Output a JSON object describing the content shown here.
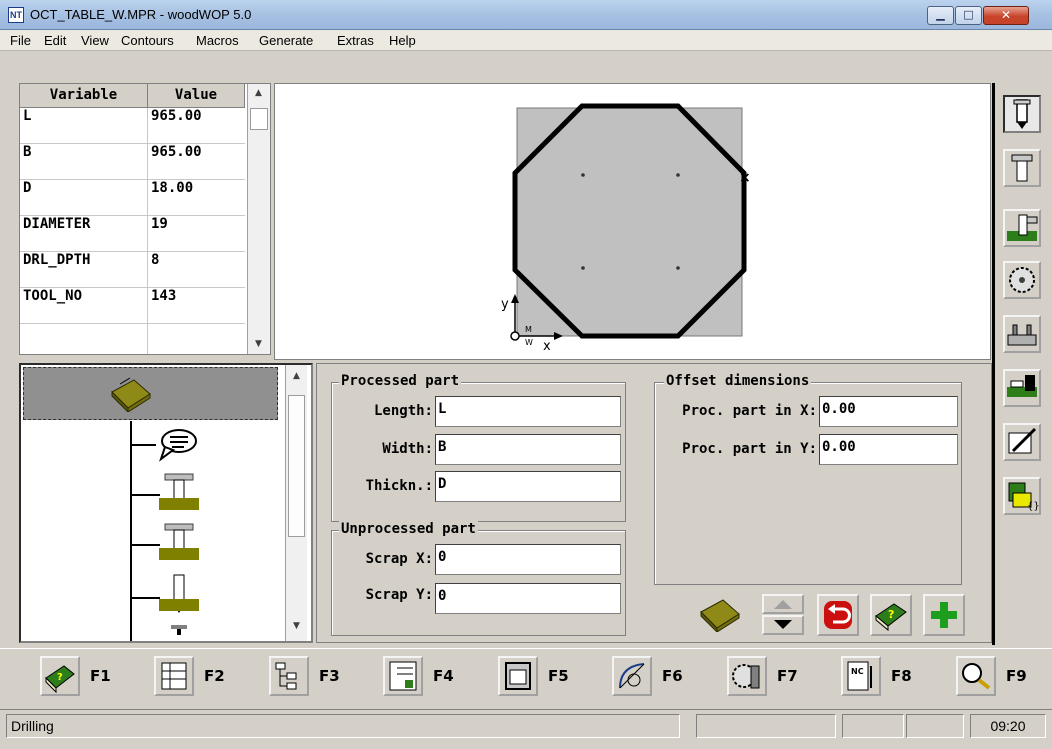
{
  "window": {
    "title": "OCT_TABLE_W.MPR - woodWOP 5.0",
    "icon_text": "NT",
    "minimize_glyph": "▁",
    "maximize_glyph": "□",
    "close_glyph": "✕"
  },
  "menu": [
    "File",
    "Edit",
    "View",
    "Contours",
    "Macros",
    "Generate",
    "Extras",
    "Help"
  ],
  "variables": {
    "headers": [
      "Variable",
      "Value"
    ],
    "rows": [
      {
        "name": "L",
        "value": "965.00"
      },
      {
        "name": "B",
        "value": "965.00"
      },
      {
        "name": "D",
        "value": "18.00"
      },
      {
        "name": "DIAMETER",
        "value": "19"
      },
      {
        "name": "DRL_DPTH",
        "value": "8"
      },
      {
        "name": "TOOL_NO",
        "value": "143"
      },
      {
        "name": "",
        "value": ""
      }
    ]
  },
  "graphic": {
    "axis_y": "y",
    "axis_x": "x",
    "origin_m": "M",
    "origin_w": "W"
  },
  "tree": {
    "items": [
      "workpiece-icon",
      "comment-icon",
      "drill-icon",
      "drill-icon",
      "drill-icon",
      "drill-icon"
    ]
  },
  "processed_part": {
    "title": "Processed part",
    "length_label": "Length:",
    "length_value": "L",
    "width_label": "Width:",
    "width_value": "B",
    "thickness_label": "Thickn.:",
    "thickness_value": "D"
  },
  "unprocessed_part": {
    "title": "Unprocessed part",
    "scrap_x_label": "Scrap X:",
    "scrap_x_value": "0",
    "scrap_y_label": "Scrap Y:",
    "scrap_y_value": "0"
  },
  "offset_dimensions": {
    "title": "Offset dimensions",
    "x_label": "Proc. part in X:",
    "x_value": "0.00",
    "y_label": "Proc. part in Y:",
    "y_value": "0.00"
  },
  "function_keys": [
    {
      "key": "F1",
      "icon": "help-book-icon"
    },
    {
      "key": "F2",
      "icon": "variables-table-icon"
    },
    {
      "key": "F3",
      "icon": "tree-view-icon"
    },
    {
      "key": "F4",
      "icon": "list-edit-icon"
    },
    {
      "key": "F5",
      "icon": "window-icon"
    },
    {
      "key": "F6",
      "icon": "contour-icon"
    },
    {
      "key": "F7",
      "icon": "machine-icon"
    },
    {
      "key": "F8",
      "icon": "nc-file-icon"
    },
    {
      "key": "F9",
      "icon": "magnifier-icon"
    }
  ],
  "status": {
    "message": "Drilling",
    "time": "09:20"
  },
  "colors": {
    "workpiece_fill": "#c0c0c0",
    "contour": "#000000",
    "icon_green": "#2e7d1b",
    "icon_red": "#cc1010"
  }
}
